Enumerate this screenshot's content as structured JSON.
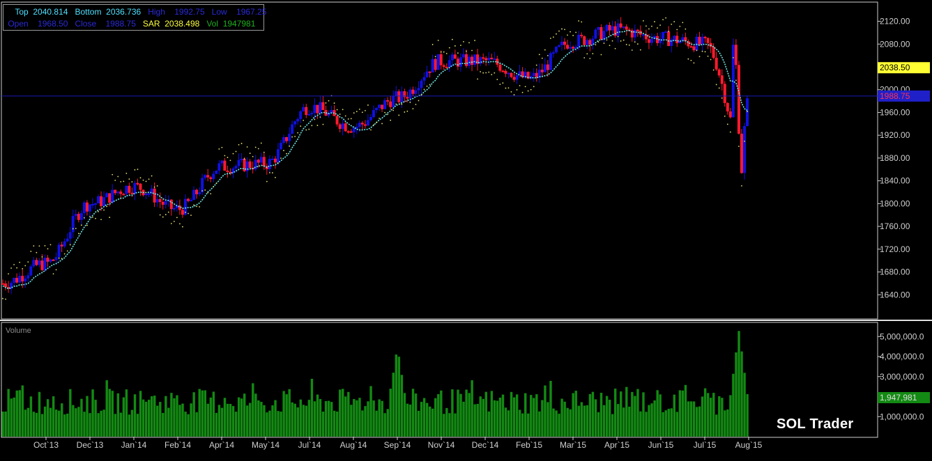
{
  "info": {
    "top_label": "Top",
    "top_value": "2040.814",
    "bottom_label": "Bottom",
    "bottom_value": "2036.736",
    "high_label": "High",
    "high_value": "1992.75",
    "low_label": "Low",
    "low_value": "1967.25",
    "open_label": "Open",
    "open_value": "1968.50",
    "close_label": "Close",
    "close_value": "1988.75",
    "sar_label": "SAR",
    "sar_value": "2038.498",
    "vol_label": "Vol",
    "vol_value": "1947981"
  },
  "colors": {
    "bull": "#1010e0",
    "bear": "#ff1a2e",
    "sar": "#e8e070",
    "band": "#6fe6e6",
    "volume": "#138a13",
    "axis": "#cfcfcf",
    "price_tag_bg": "#2020c8",
    "price_tag_text": "#ff3355",
    "sar_tag_bg": "#ffff33",
    "vol_tag_bg": "#138a13"
  },
  "chart_data": {
    "type": "line",
    "title": "",
    "price_axis": {
      "ylim": [
        1600,
        2150
      ],
      "ticks": [
        "1640.00",
        "1680.00",
        "1720.00",
        "1760.00",
        "1800.00",
        "1840.00",
        "1880.00",
        "1920.00",
        "1960.00",
        "2000.00",
        "2040.00",
        "2080.00",
        "2120.00"
      ]
    },
    "volume_axis": {
      "label": "Volume",
      "ylim": [
        0,
        5600000
      ],
      "ticks": [
        "1,000,000.0",
        "2,000,000.0",
        "3,000,000.0",
        "4,000,000.0",
        "5,000,000.0"
      ]
    },
    "x_labels": [
      "Oct`13",
      "Dec`13",
      "Jan`14",
      "Feb`14",
      "Apr`14",
      "May`14",
      "Jul`14",
      "Aug`14",
      "Sep`14",
      "Nov`14",
      "Dec`14",
      "Feb`15",
      "Mar`15",
      "Apr`15",
      "Jun`15",
      "Jul`15",
      "Aug`15"
    ],
    "series": [
      {
        "values_by_month": [
          {
            "x": "Oct`13",
            "y": 1695
          },
          {
            "x": "Dec`13",
            "y": 1800
          },
          {
            "x": "Jan`14",
            "y": 1830
          },
          {
            "x": "Feb`14",
            "y": 1790
          },
          {
            "x": "Apr`14",
            "y": 1865
          },
          {
            "x": "May`14",
            "y": 1870
          },
          {
            "x": "Jul`14",
            "y": 1970
          },
          {
            "x": "Aug`14",
            "y": 1935
          },
          {
            "x": "Sep`14",
            "y": 1985
          },
          {
            "x": "Nov`14",
            "y": 2050
          },
          {
            "x": "Dec`14",
            "y": 2050
          },
          {
            "x": "Feb`15",
            "y": 2020
          },
          {
            "x": "Mar`15",
            "y": 2085
          },
          {
            "x": "Apr`15",
            "y": 2105
          },
          {
            "x": "Jun`15",
            "y": 2090
          },
          {
            "x": "Jul`15",
            "y": 2080
          },
          {
            "x": "Aug`15",
            "y": 1870
          }
        ]
      }
    ],
    "last_close_tag": "1988.75",
    "sar_tag": "2038.50",
    "volume_tag": "1,947,981",
    "volume_peaks": [
      {
        "x": "Sep`14",
        "y": 4500000
      },
      {
        "x": "Aug`15",
        "y": 5300000
      }
    ]
  },
  "brand": "SOL Trader"
}
